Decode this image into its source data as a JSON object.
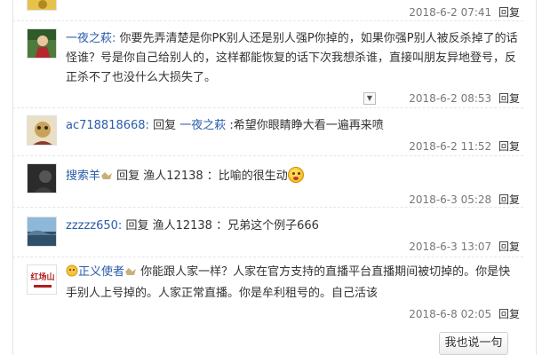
{
  "comments": [
    {
      "time": "2018-6-2 07:41",
      "reply_label": "回复"
    },
    {
      "username": "一夜之萩:",
      "text": " 你要先弄清楚是你PK别人还是别人强P你掉的，如果你强P别人被反杀掉了的话怪谁？号是你自己给别人的，这样都能恢复的话下次我想杀谁，直接叫朋友异地登号，反正杀不了也没什么大损失了。",
      "time": "2018-6-2 08:53",
      "reply_label": "回复"
    },
    {
      "username": "ac718818668:",
      "reply_word": " 回复 ",
      "reply_to": "一夜之萩",
      "text": " :希望你眼睛睁大看一遍再来喷",
      "time": "2018-6-2 11:52",
      "reply_label": "回复"
    },
    {
      "username": "搜索羊",
      "reply_word": " 回复 ",
      "reply_to": "渔人12138",
      "text": " ：比喻的很生动",
      "time": "2018-6-3 05:28",
      "reply_label": "回复"
    },
    {
      "username": "zzzzz650:",
      "reply_word": " 回复 ",
      "reply_to": "渔人12138",
      "text": " ：兄弟这个例子666",
      "time": "2018-6-3 13:07",
      "reply_label": "回复"
    },
    {
      "username": "正义使者",
      "text": "你能跟人家一样？人家在官方支持的直播平台直播期间被切掉的。你是快手别人上号掉的。人家正常直播。你是牟利租号的。自己活该",
      "avatar_text": "红场山",
      "time": "2018-6-8 02:05",
      "reply_label": "回复"
    }
  ],
  "say_button": "我也说一句",
  "dropdown_symbol": "▼"
}
